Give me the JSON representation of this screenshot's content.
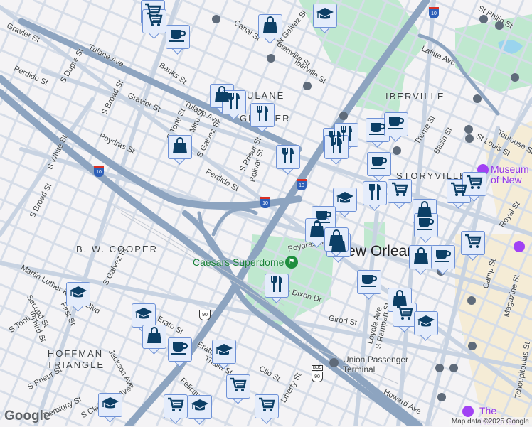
{
  "map": {
    "streets": [
      "Tulane Ave",
      "Tulane Ave",
      "Canal St",
      "Gravier St",
      "Gravier St",
      "Perdido St",
      "Perdido St",
      "S Dupre St",
      "S Broad St",
      "S Broad St",
      "Banks St",
      "Poydras St",
      "Poydras St",
      "S White St",
      "S Tonti St",
      "Miro St",
      "S Galvez St",
      "S Prieur St",
      "Bolivar St",
      "N Galvez St",
      "Bienville St",
      "Iberville St",
      "Lafitte Ave",
      "St Philip St",
      "Treme St",
      "Basin St",
      "St Louis St",
      "Martin Luther King Jr Blvd",
      "Second St",
      "First St",
      "Third St",
      "S Tonti St",
      "S Galvez St",
      "Erato St",
      "Erato St",
      "Thalia St",
      "Jackson Ave",
      "S Prieur St",
      "Derbigny St",
      "S Claiborne Ave",
      "Felicity St",
      "Clio St",
      "Liberty St",
      "Girod St",
      "Loyola Ave",
      "S Rampart St",
      "Howard Ave",
      "Camp St",
      "Magazine St",
      "Tchoupitoulas St",
      "Dave Dixon Dr",
      "Royal St",
      "Toulouse St"
    ],
    "districts": [
      "B. W. COOPER",
      "HOFFMAN TRIANGLE",
      "IBERVILLE",
      "STORYVILLE",
      "TULANE - GRAVIER"
    ],
    "city_label": "New Orleans",
    "places": {
      "superdome": "Caesars Superdome",
      "union_terminal": "Union Passenger Terminal",
      "museum": "Museum of New Orleans",
      "national": "The National"
    },
    "highway_shields": [
      "10",
      "10",
      "10",
      "10",
      "90",
      "90"
    ],
    "bus_label": "BUS",
    "markers": [
      "cart",
      "cart",
      "coffee",
      "bag",
      "grad",
      "bag",
      "food",
      "food",
      "bag",
      "food",
      "food",
      "food",
      "food",
      "coffee",
      "coffee",
      "coffee",
      "grad",
      "food",
      "cart",
      "cart",
      "cart",
      "bag",
      "coffee",
      "bag",
      "bag",
      "coffee",
      "bag",
      "coffee",
      "cart",
      "bag",
      "coffee",
      "bag",
      "cart",
      "grad",
      "grad",
      "grad",
      "bag",
      "coffee",
      "grad",
      "cart",
      "cart",
      "grad",
      "cart",
      "grad",
      "food"
    ],
    "google_logo": "Google",
    "attribution": "Map data ©2025 Google"
  }
}
